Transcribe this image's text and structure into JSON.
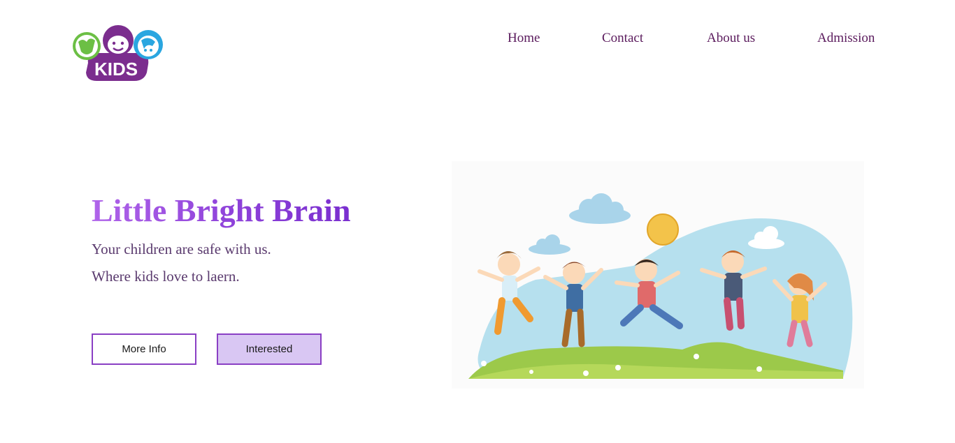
{
  "logo": {
    "text": "KIDS",
    "icon": "kids-faces-logo-icon"
  },
  "nav": {
    "items": [
      {
        "label": "Home"
      },
      {
        "label": "Contact"
      },
      {
        "label": "About us"
      },
      {
        "label": "Admission"
      }
    ]
  },
  "hero": {
    "title": "Little Bright Brain",
    "subtitle_1": "Your children are safe with us.",
    "subtitle_2": "Where kids love to laern.",
    "buttons": {
      "more_info": "More Info",
      "interested": "Interested"
    },
    "illustration": "jumping-kids-illustration"
  },
  "colors": {
    "nav_text": "#5a1a5c",
    "title_gradient_start": "#b064ea",
    "title_gradient_end": "#7a2fcf",
    "button_border": "#8a3fc4",
    "interested_bg": "#d9c7f3",
    "logo_purple": "#7b2d8e",
    "logo_green": "#6cbf45",
    "logo_blue": "#2aa6e0"
  }
}
